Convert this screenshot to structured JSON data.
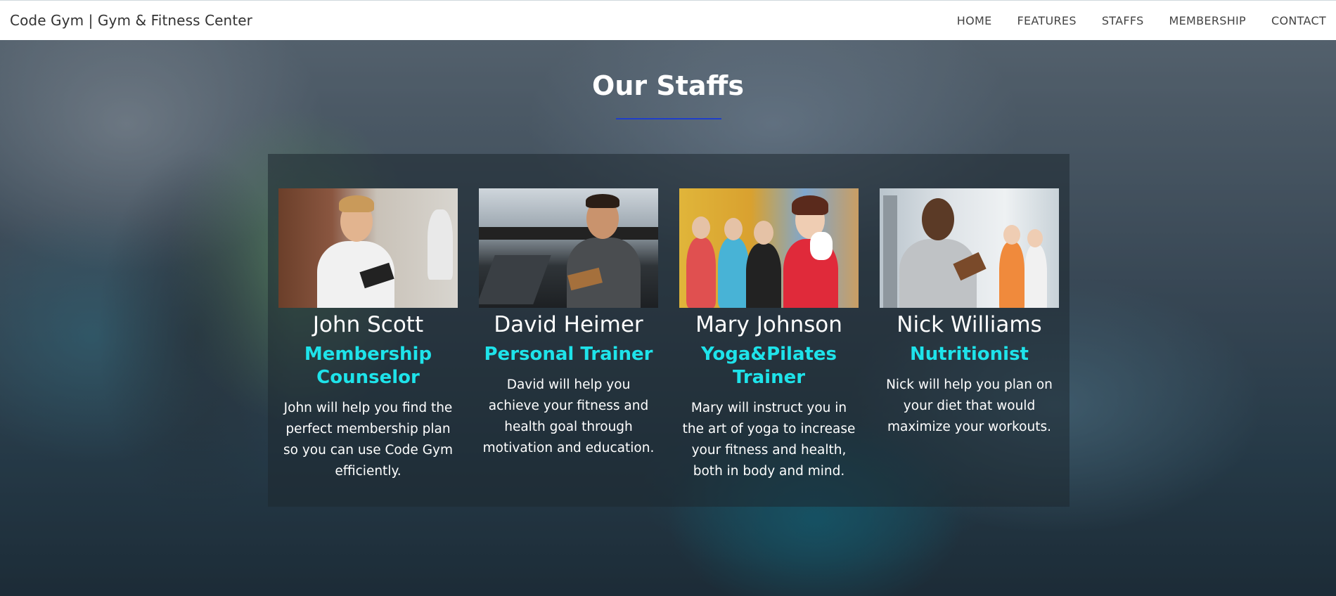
{
  "navbar": {
    "brand": "Code Gym | Gym & Fitness Center",
    "links": [
      "HOME",
      "FEATURES",
      "STAFFS",
      "MEMBERSHIP",
      "CONTACT"
    ]
  },
  "section": {
    "title": "Our Staffs",
    "underline_color": "#1f3ec9"
  },
  "colors": {
    "accent_role": "#1ee3ea",
    "panel_bg": "rgba(30,40,48,0.55)"
  },
  "staff": [
    {
      "name": "John Scott",
      "role": "Membership Counselor",
      "description": "John will help you find the perfect membership plan so you can use Code Gym efficiently.",
      "photo_icon": "trainer-photo"
    },
    {
      "name": "David Heimer",
      "role": "Personal Trainer",
      "description": "David will help you achieve your fitness and health goal through motivation and education.",
      "photo_icon": "trainer-photo"
    },
    {
      "name": "Mary Johnson",
      "role": "Yoga&Pilates Trainer",
      "description": "Mary will instruct you in the art of yoga to increase your fitness and health, both in body and mind.",
      "photo_icon": "trainer-photo"
    },
    {
      "name": "Nick Williams",
      "role": "Nutritionist",
      "description": "Nick will help you plan on your diet that would maximize your workouts.",
      "photo_icon": "trainer-photo"
    }
  ]
}
